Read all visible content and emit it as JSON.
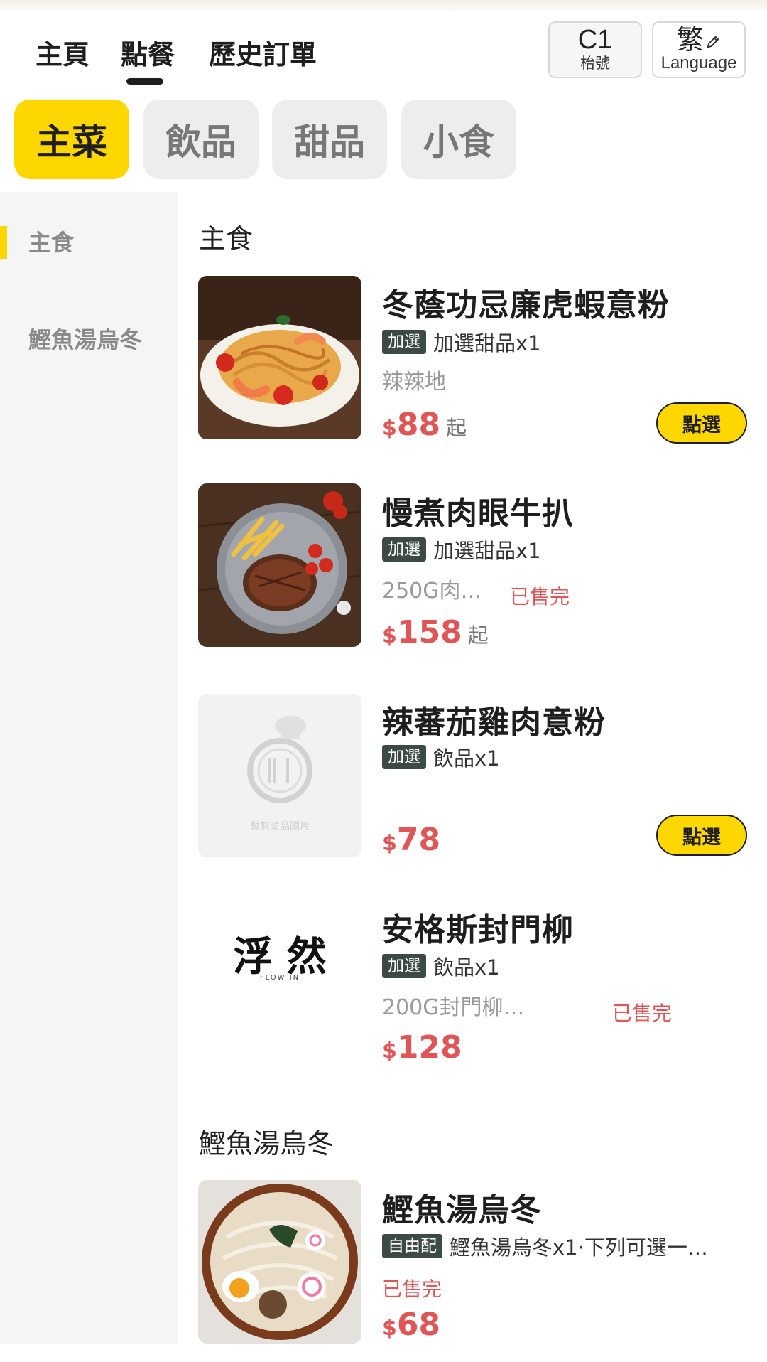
{
  "header": {
    "nav_tabs": [
      {
        "label": "主頁"
      },
      {
        "label": "點餐"
      },
      {
        "label": "歷史訂單"
      }
    ],
    "table": {
      "code": "C1",
      "label": "枱號"
    },
    "language": {
      "char": "繁",
      "label": "Language"
    }
  },
  "categories": [
    {
      "label": "主菜"
    },
    {
      "label": "飲品"
    },
    {
      "label": "甜品"
    },
    {
      "label": "小食"
    }
  ],
  "sidebar": {
    "items": [
      {
        "label": "主食"
      },
      {
        "label": "鰹魚湯烏冬"
      }
    ]
  },
  "sections": [
    {
      "title": "主食",
      "dishes": [
        {
          "name": "冬蔭功忌廉虎蝦意粉",
          "tag": "加選",
          "tag_text": "加選甜品x1",
          "desc": "辣辣地",
          "currency": "$",
          "price": "88",
          "price_suffix": "起",
          "button": "點選"
        },
        {
          "name": "慢煮肉眼牛扒",
          "tag": "加選",
          "tag_text": "加選甜品x1",
          "desc": "250G肉…",
          "sold_out": "已售完",
          "currency": "$",
          "price": "158",
          "price_suffix": "起"
        },
        {
          "name": "辣蕃茄雞肉意粉",
          "tag": "加選",
          "tag_text": "飲品x1",
          "placeholder_text": "暫無菜品圖片",
          "currency": "$",
          "price": "78",
          "button": "點選"
        },
        {
          "name": "安格斯封門柳",
          "tag": "加選",
          "tag_text": "飲品x1",
          "desc": "200G封門柳…",
          "sold_out": "已售完",
          "currency": "$",
          "price": "128",
          "logo_text": "浮 然",
          "logo_sub": "FLOW IN"
        }
      ]
    },
    {
      "title": "鰹魚湯烏冬",
      "dishes": [
        {
          "name": "鰹魚湯烏冬",
          "tag": "自由配",
          "tag_text": "鰹魚湯烏冬x1·下列可選一…",
          "sold_out": "已售完",
          "currency": "$",
          "price": "68"
        }
      ]
    }
  ],
  "colors": {
    "accent": "#ffd700",
    "price": "#e05555",
    "tag_bg": "#3c4a43",
    "sidebar_bg": "#f5f5f5"
  }
}
